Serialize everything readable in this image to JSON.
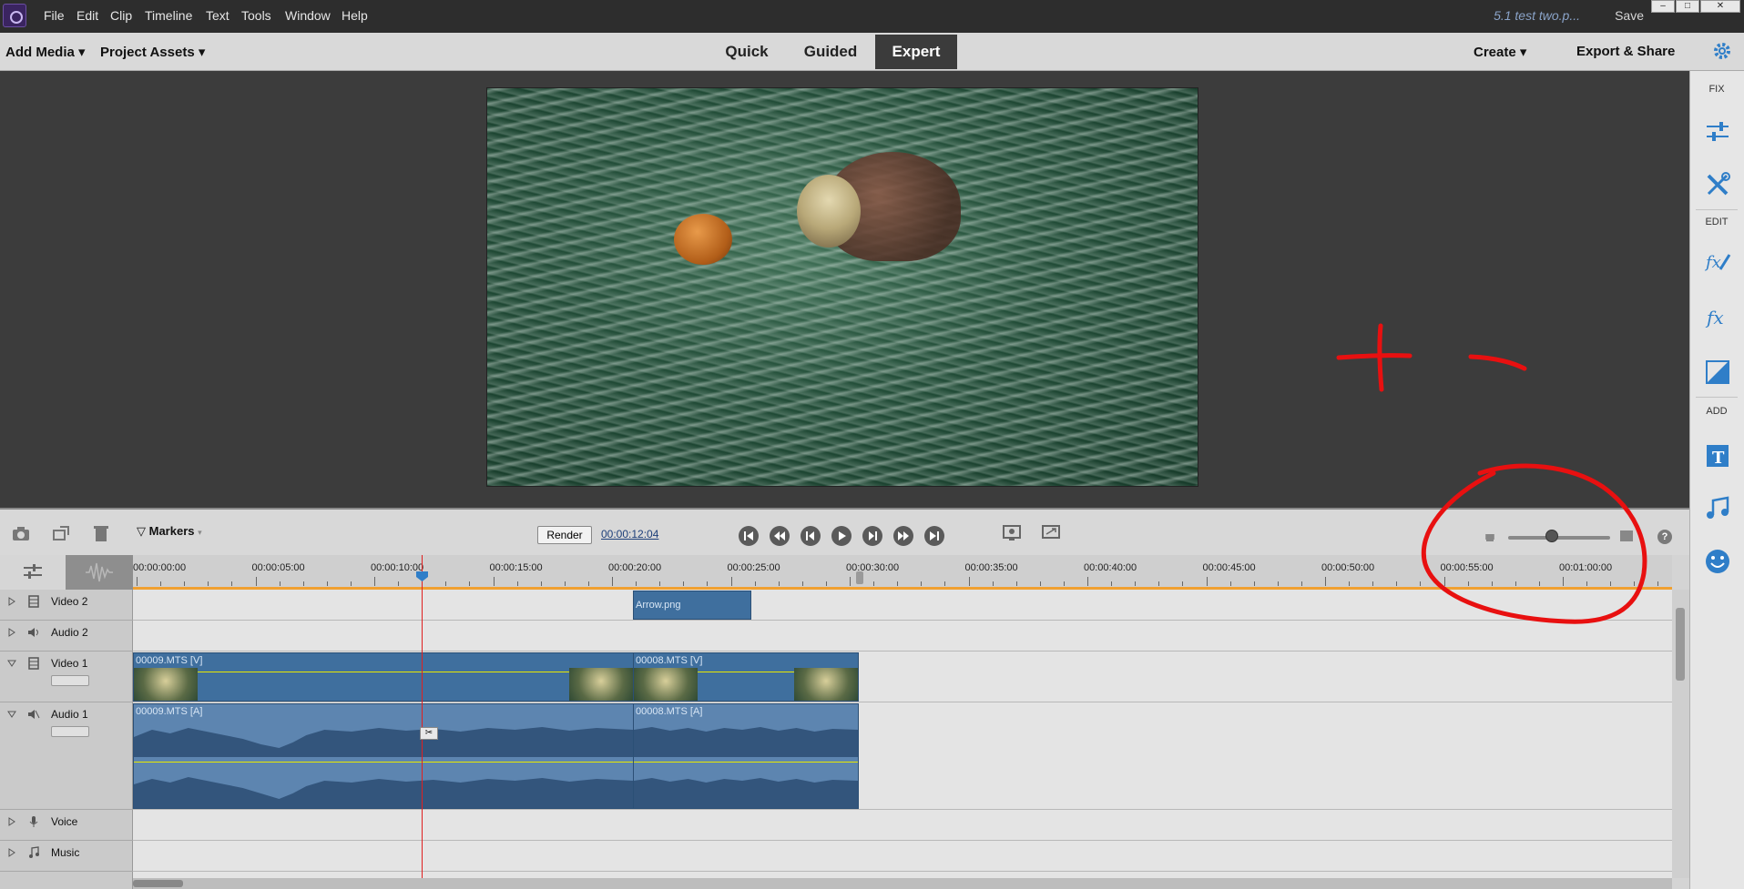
{
  "menubar": {
    "items": [
      "File",
      "Edit",
      "Clip",
      "Timeline",
      "Text",
      "Tools",
      "Window",
      "Help"
    ],
    "doc_title": "5.1 test two.p...",
    "save_label": "Save"
  },
  "modebar": {
    "add_media": "Add Media",
    "project_assets": "Project Assets",
    "tabs": [
      "Quick",
      "Guided",
      "Expert"
    ],
    "active_tab": "Expert",
    "create": "Create",
    "export_share": "Export & Share"
  },
  "rightpanel": {
    "fix_label": "FIX",
    "edit_label": "EDIT",
    "add_label": "ADD",
    "icons": [
      "adjust-icon",
      "tools-icon",
      "fx-edit-icon",
      "fx-icon",
      "transition-icon",
      "title-icon",
      "music-icon",
      "graphics-icon"
    ]
  },
  "timeline_toolbar": {
    "markers_label": "Markers",
    "render_label": "Render",
    "timecode": "00:00:12:04"
  },
  "ruler": {
    "labels": [
      "00:00:00:00",
      "00:00:05:00",
      "00:00:10:00",
      "00:00:15:00",
      "00:00:20:00",
      "00:00:25:00",
      "00:00:30:00",
      "00:00:35:00",
      "00:00:40:00",
      "00:00:45:00",
      "00:00:50:00",
      "00:00:55:00",
      "00:01:00:00"
    ]
  },
  "tracks": {
    "video2": "Video 2",
    "audio2": "Audio 2",
    "video1": "Video 1",
    "audio1": "Audio 1",
    "voice": "Voice",
    "music": "Music"
  },
  "clips": {
    "arrow": "Arrow.png",
    "v1a": "00009.MTS [V]",
    "v1b": "00008.MTS [V]",
    "a1a": "00009.MTS [A]",
    "a1b": "00008.MTS [A]"
  },
  "colors": {
    "annotation": "#e81010",
    "clip_video": "#3f6f9e",
    "clip_audio": "#5d85b0",
    "playhead": "#e02020"
  }
}
